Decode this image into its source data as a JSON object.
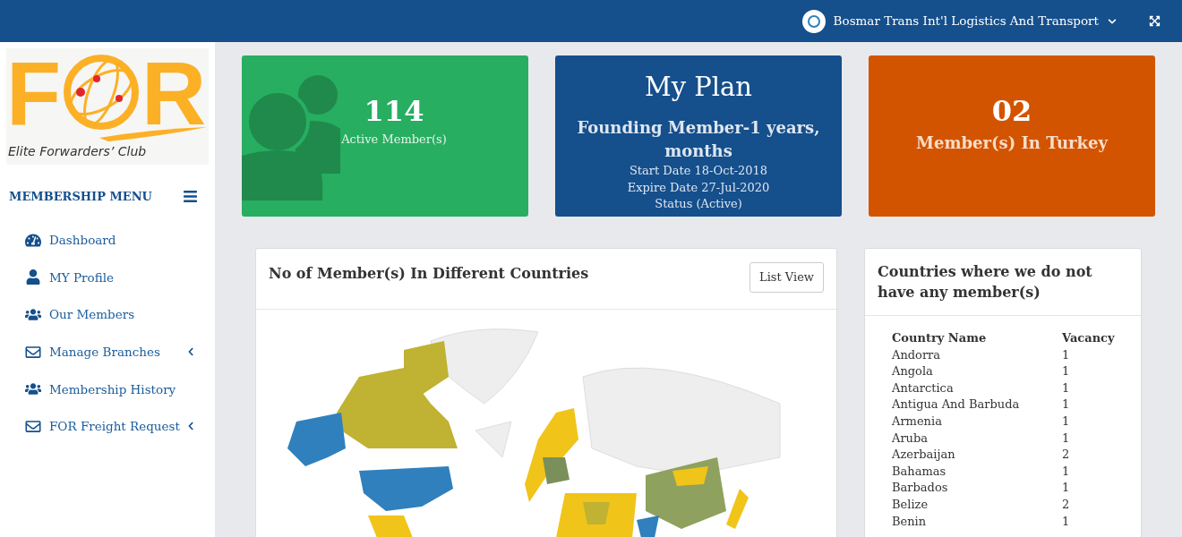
{
  "topbar": {
    "account": "Bosmar Trans Int'l Logistics And Transport"
  },
  "logo": {
    "left": "F",
    "right": "R",
    "tagline": "Elite Forwarders’ Club"
  },
  "sidebar": {
    "title": "MEMBERSHIP MENU",
    "items": [
      {
        "label": "Dashboard",
        "has_submenu": false
      },
      {
        "label": "MY Profile",
        "has_submenu": false
      },
      {
        "label": "Our Members",
        "has_submenu": false
      },
      {
        "label": "Manage Branches",
        "has_submenu": true
      },
      {
        "label": "Membership History",
        "has_submenu": false
      },
      {
        "label": "FOR Freight Request",
        "has_submenu": true
      }
    ]
  },
  "cards": [
    {
      "kind": "members",
      "value": "114",
      "label": "Active Member(s)"
    },
    {
      "kind": "plan",
      "title": "My Plan",
      "plan": "Founding Member-1 years, months",
      "lines": [
        "Start Date 18-Oct-2018",
        "Expire Date 27-Jul-2020",
        "Status (Active)"
      ]
    },
    {
      "kind": "country",
      "value": "02",
      "label": "Member(s) In Turkey"
    }
  ],
  "map_panel": {
    "title": "No of Member(s) In Different Countries",
    "button": "List View"
  },
  "vacancy_panel": {
    "title": "Countries where we do not have any member(s)",
    "columns": [
      "Country Name",
      "Vacancy"
    ],
    "rows": [
      [
        "Andorra",
        "1"
      ],
      [
        "Angola",
        "1"
      ],
      [
        "Antarctica",
        "1"
      ],
      [
        "Antigua And Barbuda",
        "1"
      ],
      [
        "Armenia",
        "1"
      ],
      [
        "Aruba",
        "1"
      ],
      [
        "Azerbaijan",
        "2"
      ],
      [
        "Bahamas",
        "1"
      ],
      [
        "Barbados",
        "1"
      ],
      [
        "Belize",
        "2"
      ],
      [
        "Benin",
        "1"
      ]
    ]
  }
}
